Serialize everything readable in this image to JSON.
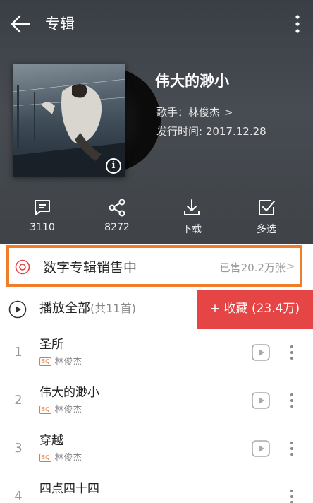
{
  "topbar": {
    "title": "专辑"
  },
  "album": {
    "title": "伟大的渺小",
    "singer_label": "歌手：林俊杰",
    "release_label": "发行时间: 2017.12.28"
  },
  "actions": [
    {
      "icon": "comment-icon",
      "label": "3110"
    },
    {
      "icon": "share-icon",
      "label": "8272"
    },
    {
      "icon": "download-icon",
      "label": "下载"
    },
    {
      "icon": "multi-select-icon",
      "label": "多选"
    }
  ],
  "sale": {
    "title": "数字专辑销售中",
    "count": "已售20.2万张"
  },
  "playall": {
    "label": "播放全部",
    "count": "(共11首)",
    "collect": "+ 收藏 (23.4万)"
  },
  "songs": [
    {
      "index": "1",
      "name": "圣所",
      "quality": "SQ",
      "artist": "林俊杰"
    },
    {
      "index": "2",
      "name": "伟大的渺小",
      "quality": "SQ",
      "artist": "林俊杰"
    },
    {
      "index": "3",
      "name": "穿越",
      "quality": "SQ",
      "artist": "林俊杰"
    },
    {
      "index": "4",
      "name": "四点四十四",
      "quality": "",
      "artist": ""
    }
  ],
  "colors": {
    "accent_red": "#e64545",
    "highlight_orange": "#f07d2a"
  }
}
